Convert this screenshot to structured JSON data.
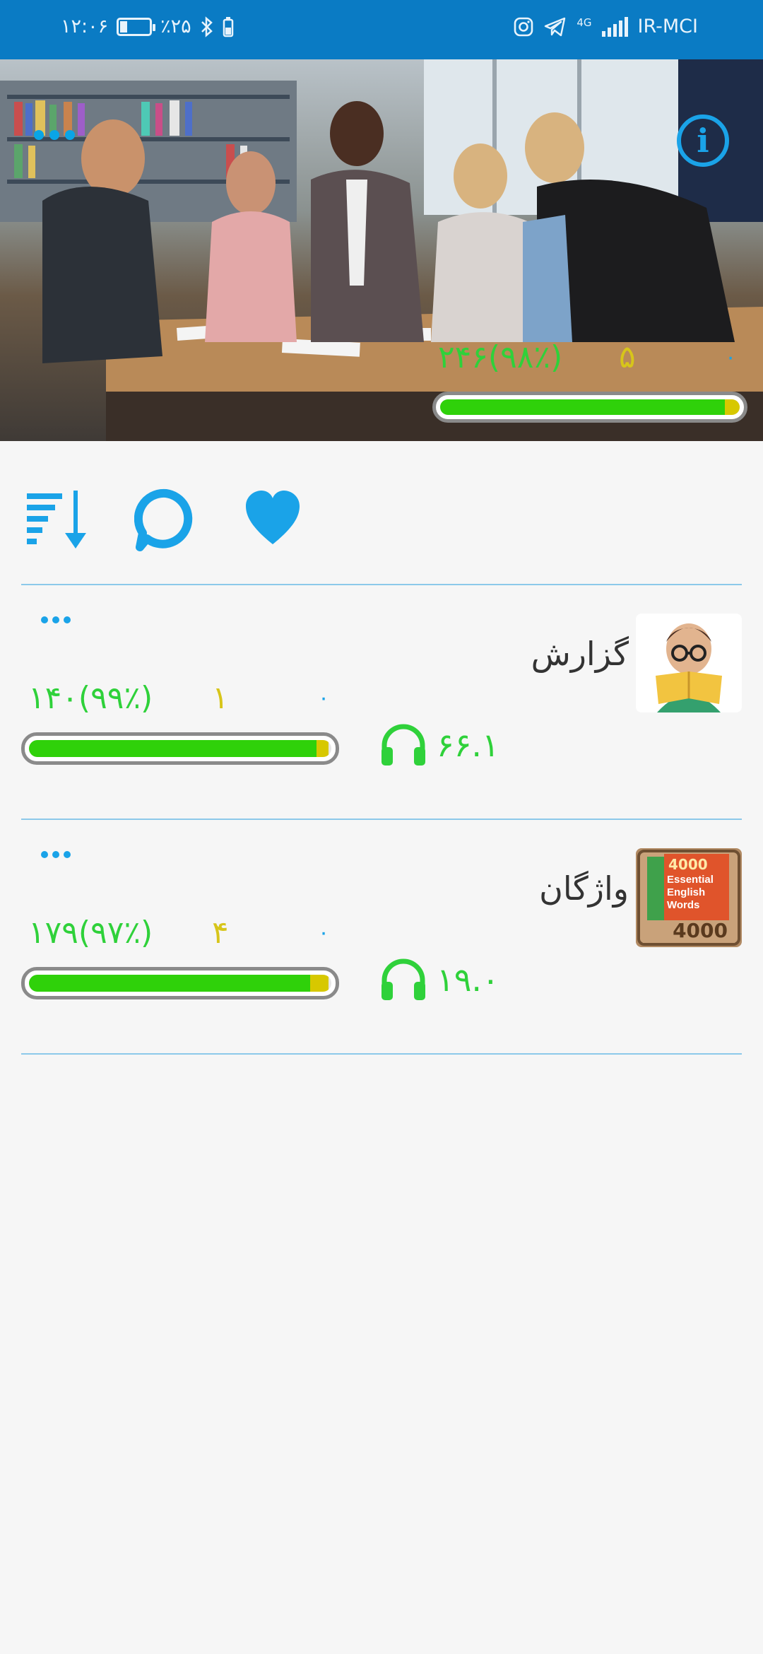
{
  "status_bar": {
    "time": "۱۲:۰۶",
    "battery": "٪۲۵",
    "network_type": "4G",
    "carrier": "IR-MCI"
  },
  "hero": {
    "total": "۲۴۶(۹۸٪)",
    "wrong": "۵",
    "unread": "۰",
    "progress_green": 0.95,
    "progress_yellow": 0.05
  },
  "toolbar": {
    "icons": [
      "sort-icon",
      "chat-icon",
      "heart-icon"
    ]
  },
  "colors": {
    "status_bar": "#0a7bc4",
    "accent_blue": "#1aa3e8",
    "green": "#2fd13a",
    "yellow": "#d7c51a",
    "background": "#f6f6f6"
  },
  "items": [
    {
      "title": "گزارش",
      "total": "۱۴۰(۹۹٪)",
      "wrong": "۱",
      "unread": "۰",
      "listen": "۶۶.۱",
      "progress_green": 0.95,
      "progress_yellow": 0.04
    },
    {
      "title": "واژگان",
      "total": "۱۷۹(۹۷٪)",
      "wrong": "۴",
      "unread": "۰",
      "listen": "۱۹.۰",
      "thumb_text_top": "4000",
      "thumb_lines": [
        "Essential",
        "English",
        "Words"
      ],
      "thumb_text_bottom": "4000",
      "progress_green": 0.93,
      "progress_yellow": 0.06
    }
  ]
}
